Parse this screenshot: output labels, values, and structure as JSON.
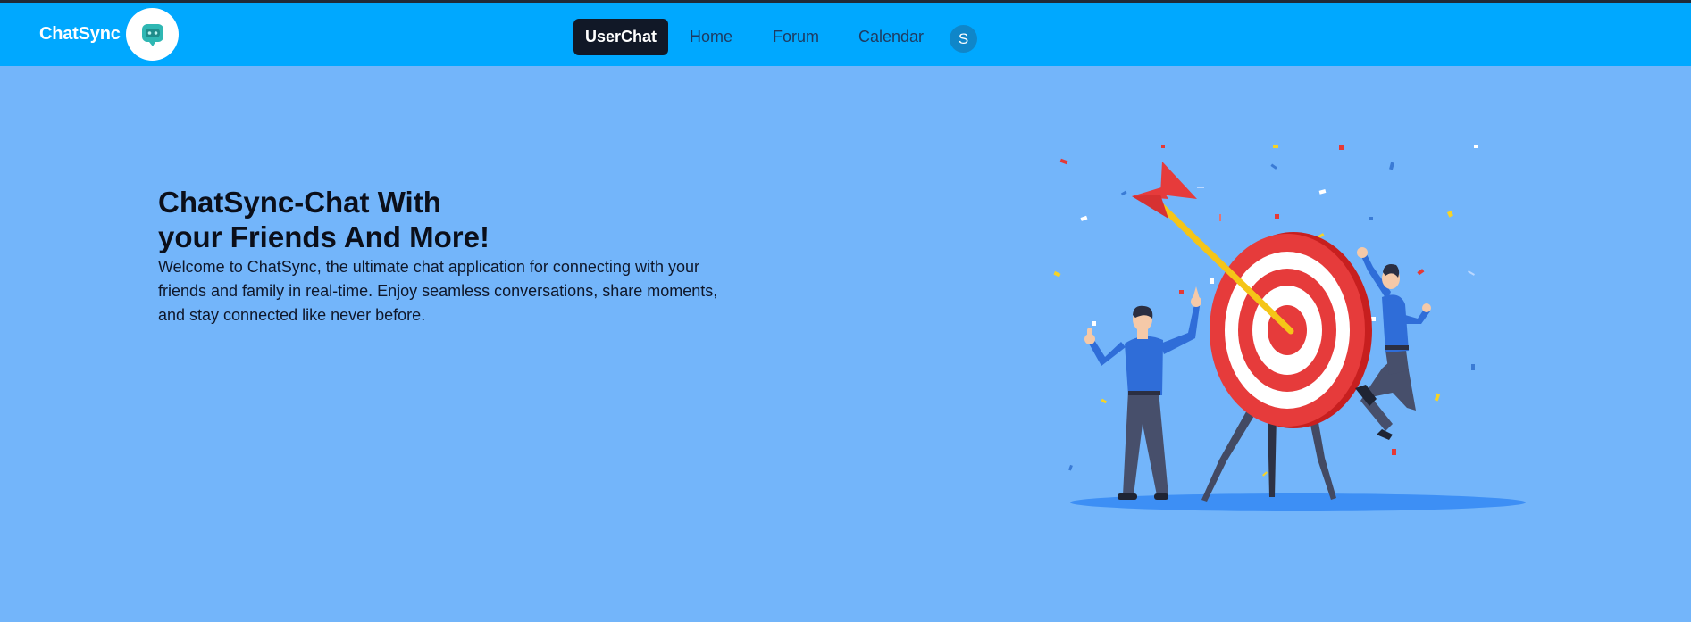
{
  "navbar": {
    "brand": "ChatSync",
    "links": [
      {
        "label": "UserChat",
        "active": true
      },
      {
        "label": "Home",
        "active": false
      },
      {
        "label": "Forum",
        "active": false
      },
      {
        "label": "Calendar",
        "active": false
      }
    ],
    "avatar_initial": "S"
  },
  "hero": {
    "title_line1": "ChatSync-Chat With",
    "title_line2": "your Friends And More!",
    "description": "Welcome to ChatSync, the ultimate chat application for connecting with your friends and family in real-time. Enjoy seamless conversations, share moments, and stay connected like never before."
  },
  "icons": {
    "logo": "chat-bot-icon",
    "illustration": "target-celebration-illustration"
  },
  "colors": {
    "navbar": "#00a8ff",
    "background": "#73b5fa",
    "active_link": "#111827",
    "avatar": "#0f86c9",
    "target_red": "#e63b3b"
  }
}
